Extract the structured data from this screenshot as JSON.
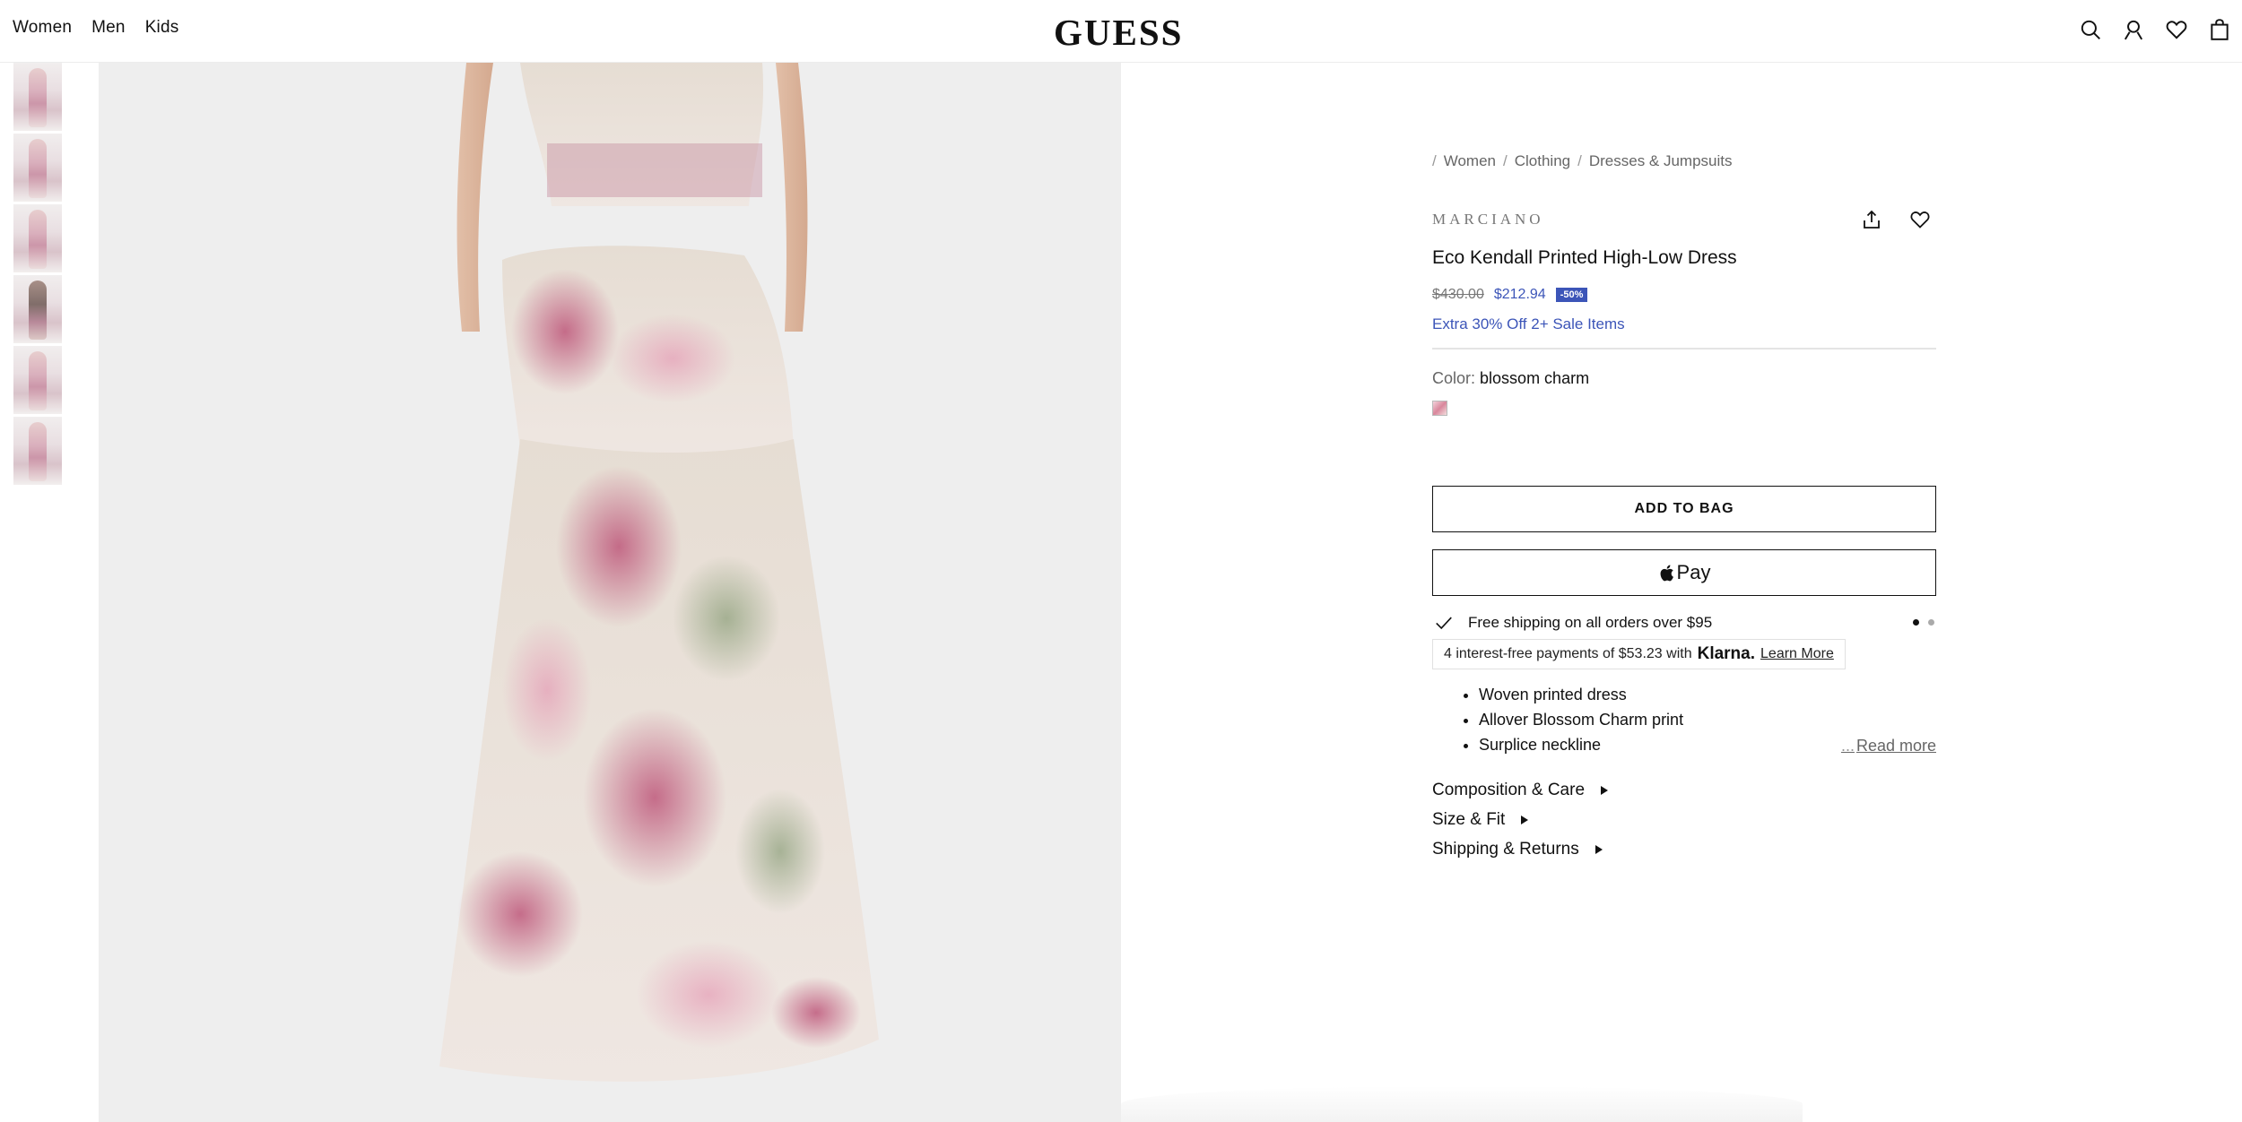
{
  "header": {
    "nav": [
      "Women",
      "Men",
      "Kids"
    ],
    "logo": "GUESS",
    "icons": [
      "search-icon",
      "account-icon",
      "wishlist-heart-icon",
      "shopping-bag-icon"
    ]
  },
  "gallery": {
    "thumbnails": 6,
    "active_image": "dress-back-view"
  },
  "breadcrumb": {
    "lead": "/",
    "items": [
      "Women",
      "Clothing",
      "Dresses & Jumpsuits"
    ],
    "sep": "/"
  },
  "product": {
    "brand": "MARCIANO",
    "title": "Eco Kendall Printed High-Low Dress",
    "price_old": "$430.00",
    "price_new": "$212.94",
    "discount": "-50%",
    "promo": "Extra 30% Off 2+ Sale Items",
    "color_label": "Color:",
    "color_value": "blossom charm"
  },
  "actions": {
    "add_to_bag": "ADD TO BAG",
    "apple_pay": "Pay"
  },
  "shipping": {
    "text": "Free shipping on all orders over $95"
  },
  "klarna": {
    "text": "4 interest-free payments of $53.23 with",
    "brand": "Klarna.",
    "link": "Learn More"
  },
  "features": {
    "items": [
      "Woven printed dress",
      "Allover Blossom Charm print",
      "Surplice neckline"
    ],
    "ellipsis": "...",
    "read_more": "Read more"
  },
  "accordion": [
    "Composition & Care",
    "Size & Fit",
    "Shipping & Returns"
  ],
  "colors": {
    "accent": "#3c55b8",
    "text": "#111111",
    "muted": "#666666"
  }
}
